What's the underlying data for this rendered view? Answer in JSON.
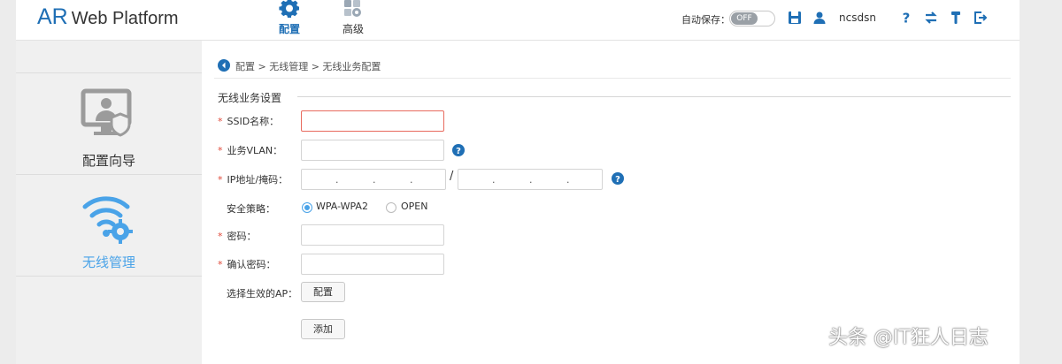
{
  "header": {
    "logo_ar": "AR",
    "logo_rest": "Web Platform",
    "nav": [
      {
        "label": "配置",
        "icon": "gear-icon",
        "active": true
      },
      {
        "label": "高级",
        "icon": "advanced-gears-icon",
        "active": false
      }
    ],
    "autosave_label": "自动保存：",
    "autosave_state": "OFF",
    "username": "ncsdsn",
    "icons": [
      "save-icon",
      "user-icon",
      "help-icon",
      "switch-icon",
      "tools-icon",
      "logout-icon"
    ]
  },
  "sidebar": {
    "items": [
      {
        "label": "配置向导",
        "icon": "wizard-monitor-icon",
        "active": false
      },
      {
        "label": "无线管理",
        "icon": "wifi-gear-icon",
        "active": true
      }
    ]
  },
  "breadcrumb": "配置 > 无线管理 > 无线业务配置",
  "form": {
    "section_title": "无线业务设置",
    "required_mark": "*",
    "ssid_label": "SSID名称：",
    "ssid_value": "",
    "vlan_label": "业务VLAN：",
    "vlan_value": "",
    "ip_label": "IP地址/掩码：",
    "ip_dot": ".",
    "ip_slash": "/",
    "security_label": "安全策略：",
    "security_options": [
      "WPA-WPA2",
      "OPEN"
    ],
    "security_selected": "WPA-WPA2",
    "password_label": "密码：",
    "confirm_label": "确认密码：",
    "ap_label": "选择生效的AP：",
    "config_button": "配置",
    "add_button": "添加"
  },
  "watermark": "头条 @IT狂人日志",
  "colors": {
    "accent": "#1f6fb5",
    "link": "#4aa3e8",
    "required": "#e04a3a"
  }
}
